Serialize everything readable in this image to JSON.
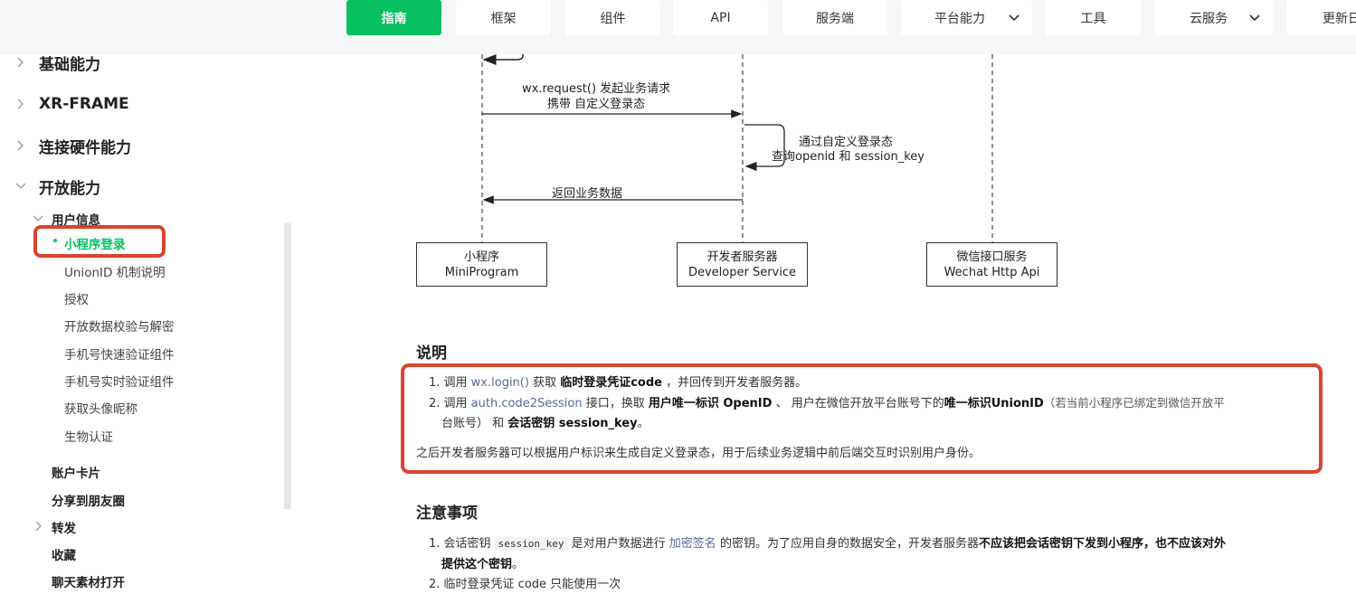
{
  "nav": {
    "items": [
      {
        "label": "指南",
        "active": true
      },
      {
        "label": "框架"
      },
      {
        "label": "组件"
      },
      {
        "label": "API"
      },
      {
        "label": "服务端"
      },
      {
        "label": "平台能力",
        "dropdown": true
      },
      {
        "label": "工具"
      },
      {
        "label": "云服务",
        "dropdown": true
      },
      {
        "label": "更新日"
      }
    ]
  },
  "sidebar": {
    "sections": [
      {
        "label": "基础能力"
      },
      {
        "label": "XR-FRAME"
      },
      {
        "label": "连接硬件能力"
      },
      {
        "label": "开放能力"
      }
    ],
    "group_user_info": "用户信息",
    "active_item": "小程序登录",
    "sub_items": [
      "UnionID 机制说明",
      "授权",
      "开放数据校验与解密",
      "手机号快速验证组件",
      "手机号实时验证组件",
      "获取头像昵称",
      "生物认证"
    ],
    "groups_after": [
      {
        "label": "账户卡片",
        "expandable": false
      },
      {
        "label": "分享到朋友圈",
        "expandable": false
      },
      {
        "label": "转发",
        "expandable": true
      },
      {
        "label": "收藏",
        "expandable": false
      },
      {
        "label": "聊天素材打开",
        "expandable": false
      }
    ]
  },
  "diagram": {
    "msg_request_line1": "wx.request() 发起业务请求",
    "msg_request_line2": "携带 自定义登录态",
    "msg_query_line1": "通过自定义登录态",
    "msg_query_line2": "查询openid 和 session_key",
    "msg_return": "返回业务数据",
    "actors": [
      {
        "line1": "小程序",
        "line2": "MiniProgram"
      },
      {
        "line1": "开发者服务器",
        "line2": "Developer Service"
      },
      {
        "line1": "微信接口服务",
        "line2": "Wechat Http Api"
      }
    ]
  },
  "explain": {
    "heading": "说明",
    "item1_prefix": "1. 调用 ",
    "item1_link": "wx.login()",
    "item1_mid": " 获取 ",
    "item1_bold": "临时登录凭证code",
    "item1_suffix": " ，并回传到开发者服务器。",
    "item2_prefix": "2. 调用 ",
    "item2_link": "auth.code2Session",
    "item2_mid1": " 接口，换取 ",
    "item2_bold1": "用户唯一标识 OpenID",
    "item2_mid2": " 、 用户在微信开放平台账号下的",
    "item2_bold2": "唯一标识UnionID",
    "item2_mid3": "（若当前小程序已绑定到微信开放平",
    "item2_line2_pre": "台账号） 和 ",
    "item2_bold3": "会话密钥 session_key",
    "item2_line2_suf": "。",
    "summary": "之后开发者服务器可以根据用户标识来生成自定义登录态，用于后续业务逻辑中前后端交互时识别用户身份。"
  },
  "notes": {
    "heading": "注意事项",
    "item1_prefix": "1. 会话密钥 ",
    "item1_code": "session_key",
    "item1_mid": " 是对用户数据进行 ",
    "item1_link": "加密签名",
    "item1_mid2": " 的密钥。为了应用自身的数据安全，开发者服务器",
    "item1_bold": "不应该把会话密钥下发到小程序，也不应该对外",
    "item1_line2_bold": "提供这个密钥",
    "item1_line2_suf": "。",
    "item2": "2. 临时登录凭证 code 只能使用一次"
  },
  "colors": {
    "accent": "#07c160",
    "highlight_border": "#d9442c",
    "link": "#576b95"
  }
}
